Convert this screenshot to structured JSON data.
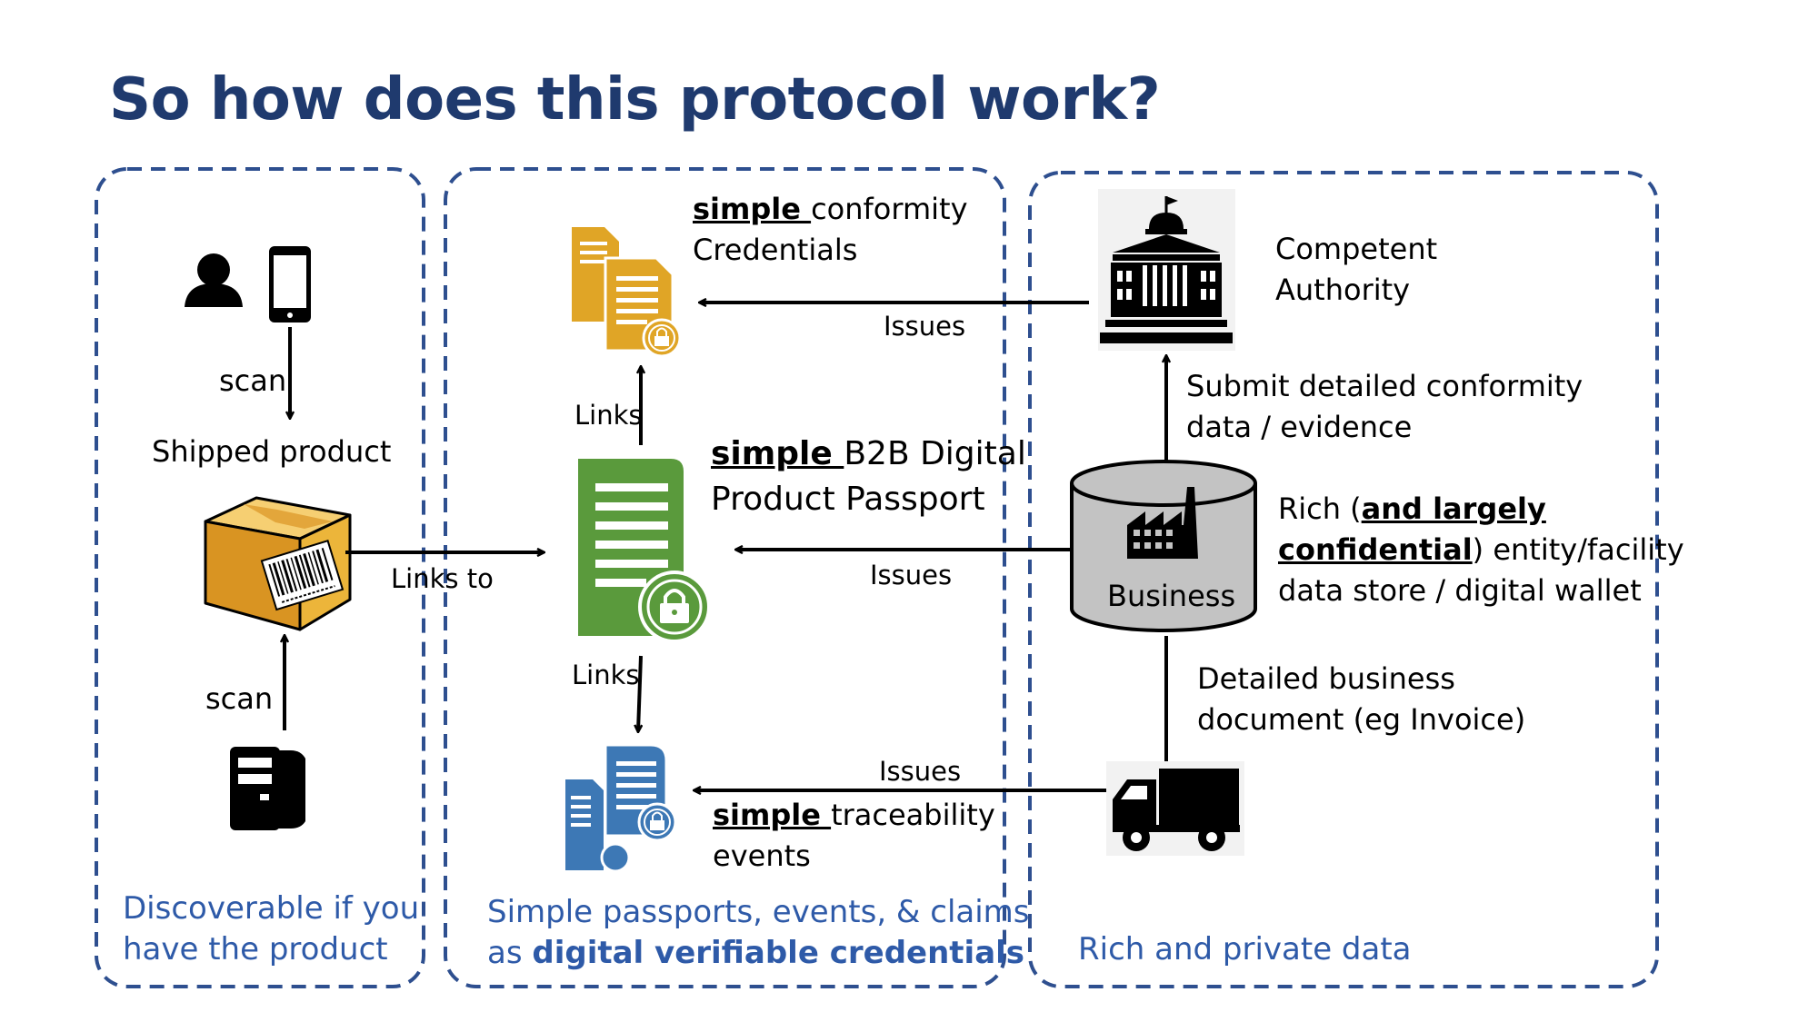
{
  "title": "So how does this protocol work?",
  "panels": {
    "left": {
      "scan_top": "scan",
      "shipped_product": "Shipped product",
      "links_to": "Links to",
      "scan_bottom": "scan",
      "caption_line1": "Discoverable if you",
      "caption_line2": "have the product"
    },
    "middle": {
      "conformity_bold": "simple ",
      "conformity_rest": "conformity",
      "conformity_line2": "Credentials",
      "links_up": "Links",
      "passport_bold": "simple ",
      "passport_rest": "B2B Digital",
      "passport_line2": "Product Passport",
      "links_down": "Links",
      "traceability_bold": "simple ",
      "traceability_rest": "traceability",
      "traceability_line2": "events",
      "caption_line1": "Simple passports, events, & claims",
      "caption_line2_pre": "as ",
      "caption_line2_bold": "digital verifiable credentials"
    },
    "right": {
      "issues_authority": "Issues",
      "issues_business": "Issues",
      "issues_truck": "Issues",
      "authority_line1": "Competent",
      "authority_line2": "Authority",
      "submit_line1": "Submit detailed conformity",
      "submit_line2": "data / evidence",
      "business_label": "Business",
      "rich_pre": "Rich (",
      "rich_bold1": "and largely",
      "rich_bold2": "confidential",
      "rich_post": ") entity/facility",
      "rich_line3": "data store / digital wallet",
      "detailed_line1": "Detailed business",
      "detailed_line2": "document (eg Invoice)",
      "caption": "Rich and  private data"
    }
  },
  "colors": {
    "title": "#1f3a6e",
    "dashed_border": "#2e4f8f",
    "caption": "#2e5aa8",
    "credential_gold": "#e0a526",
    "passport_green": "#5a9a3c",
    "event_blue": "#3d78b5",
    "box_gold": "#ecb53a"
  }
}
